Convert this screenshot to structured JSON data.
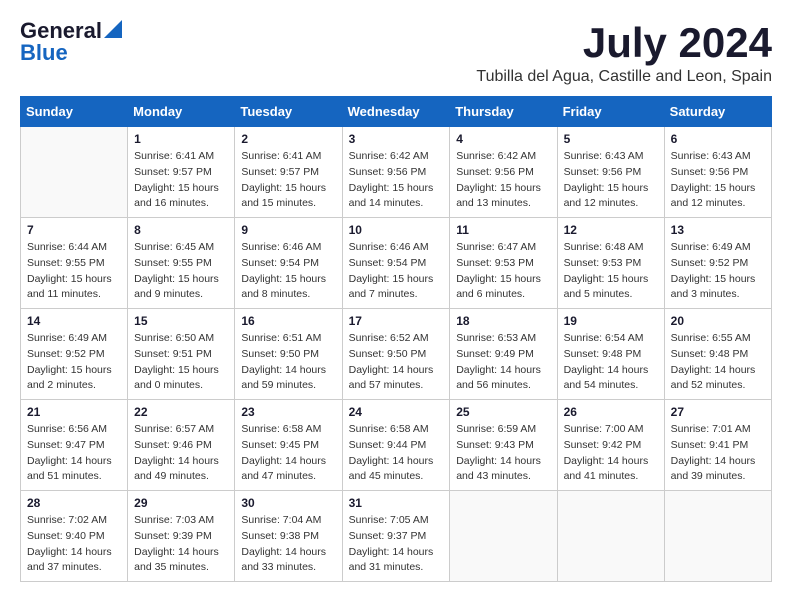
{
  "header": {
    "logo_general": "General",
    "logo_blue": "Blue",
    "month_title": "July 2024",
    "location": "Tubilla del Agua, Castille and Leon, Spain"
  },
  "days_of_week": [
    "Sunday",
    "Monday",
    "Tuesday",
    "Wednesday",
    "Thursday",
    "Friday",
    "Saturday"
  ],
  "weeks": [
    [
      {
        "day": "",
        "info": ""
      },
      {
        "day": "1",
        "info": "Sunrise: 6:41 AM\nSunset: 9:57 PM\nDaylight: 15 hours\nand 16 minutes."
      },
      {
        "day": "2",
        "info": "Sunrise: 6:41 AM\nSunset: 9:57 PM\nDaylight: 15 hours\nand 15 minutes."
      },
      {
        "day": "3",
        "info": "Sunrise: 6:42 AM\nSunset: 9:56 PM\nDaylight: 15 hours\nand 14 minutes."
      },
      {
        "day": "4",
        "info": "Sunrise: 6:42 AM\nSunset: 9:56 PM\nDaylight: 15 hours\nand 13 minutes."
      },
      {
        "day": "5",
        "info": "Sunrise: 6:43 AM\nSunset: 9:56 PM\nDaylight: 15 hours\nand 12 minutes."
      },
      {
        "day": "6",
        "info": "Sunrise: 6:43 AM\nSunset: 9:56 PM\nDaylight: 15 hours\nand 12 minutes."
      }
    ],
    [
      {
        "day": "7",
        "info": "Sunrise: 6:44 AM\nSunset: 9:55 PM\nDaylight: 15 hours\nand 11 minutes."
      },
      {
        "day": "8",
        "info": "Sunrise: 6:45 AM\nSunset: 9:55 PM\nDaylight: 15 hours\nand 9 minutes."
      },
      {
        "day": "9",
        "info": "Sunrise: 6:46 AM\nSunset: 9:54 PM\nDaylight: 15 hours\nand 8 minutes."
      },
      {
        "day": "10",
        "info": "Sunrise: 6:46 AM\nSunset: 9:54 PM\nDaylight: 15 hours\nand 7 minutes."
      },
      {
        "day": "11",
        "info": "Sunrise: 6:47 AM\nSunset: 9:53 PM\nDaylight: 15 hours\nand 6 minutes."
      },
      {
        "day": "12",
        "info": "Sunrise: 6:48 AM\nSunset: 9:53 PM\nDaylight: 15 hours\nand 5 minutes."
      },
      {
        "day": "13",
        "info": "Sunrise: 6:49 AM\nSunset: 9:52 PM\nDaylight: 15 hours\nand 3 minutes."
      }
    ],
    [
      {
        "day": "14",
        "info": "Sunrise: 6:49 AM\nSunset: 9:52 PM\nDaylight: 15 hours\nand 2 minutes."
      },
      {
        "day": "15",
        "info": "Sunrise: 6:50 AM\nSunset: 9:51 PM\nDaylight: 15 hours\nand 0 minutes."
      },
      {
        "day": "16",
        "info": "Sunrise: 6:51 AM\nSunset: 9:50 PM\nDaylight: 14 hours\nand 59 minutes."
      },
      {
        "day": "17",
        "info": "Sunrise: 6:52 AM\nSunset: 9:50 PM\nDaylight: 14 hours\nand 57 minutes."
      },
      {
        "day": "18",
        "info": "Sunrise: 6:53 AM\nSunset: 9:49 PM\nDaylight: 14 hours\nand 56 minutes."
      },
      {
        "day": "19",
        "info": "Sunrise: 6:54 AM\nSunset: 9:48 PM\nDaylight: 14 hours\nand 54 minutes."
      },
      {
        "day": "20",
        "info": "Sunrise: 6:55 AM\nSunset: 9:48 PM\nDaylight: 14 hours\nand 52 minutes."
      }
    ],
    [
      {
        "day": "21",
        "info": "Sunrise: 6:56 AM\nSunset: 9:47 PM\nDaylight: 14 hours\nand 51 minutes."
      },
      {
        "day": "22",
        "info": "Sunrise: 6:57 AM\nSunset: 9:46 PM\nDaylight: 14 hours\nand 49 minutes."
      },
      {
        "day": "23",
        "info": "Sunrise: 6:58 AM\nSunset: 9:45 PM\nDaylight: 14 hours\nand 47 minutes."
      },
      {
        "day": "24",
        "info": "Sunrise: 6:58 AM\nSunset: 9:44 PM\nDaylight: 14 hours\nand 45 minutes."
      },
      {
        "day": "25",
        "info": "Sunrise: 6:59 AM\nSunset: 9:43 PM\nDaylight: 14 hours\nand 43 minutes."
      },
      {
        "day": "26",
        "info": "Sunrise: 7:00 AM\nSunset: 9:42 PM\nDaylight: 14 hours\nand 41 minutes."
      },
      {
        "day": "27",
        "info": "Sunrise: 7:01 AM\nSunset: 9:41 PM\nDaylight: 14 hours\nand 39 minutes."
      }
    ],
    [
      {
        "day": "28",
        "info": "Sunrise: 7:02 AM\nSunset: 9:40 PM\nDaylight: 14 hours\nand 37 minutes."
      },
      {
        "day": "29",
        "info": "Sunrise: 7:03 AM\nSunset: 9:39 PM\nDaylight: 14 hours\nand 35 minutes."
      },
      {
        "day": "30",
        "info": "Sunrise: 7:04 AM\nSunset: 9:38 PM\nDaylight: 14 hours\nand 33 minutes."
      },
      {
        "day": "31",
        "info": "Sunrise: 7:05 AM\nSunset: 9:37 PM\nDaylight: 14 hours\nand 31 minutes."
      },
      {
        "day": "",
        "info": ""
      },
      {
        "day": "",
        "info": ""
      },
      {
        "day": "",
        "info": ""
      }
    ]
  ]
}
